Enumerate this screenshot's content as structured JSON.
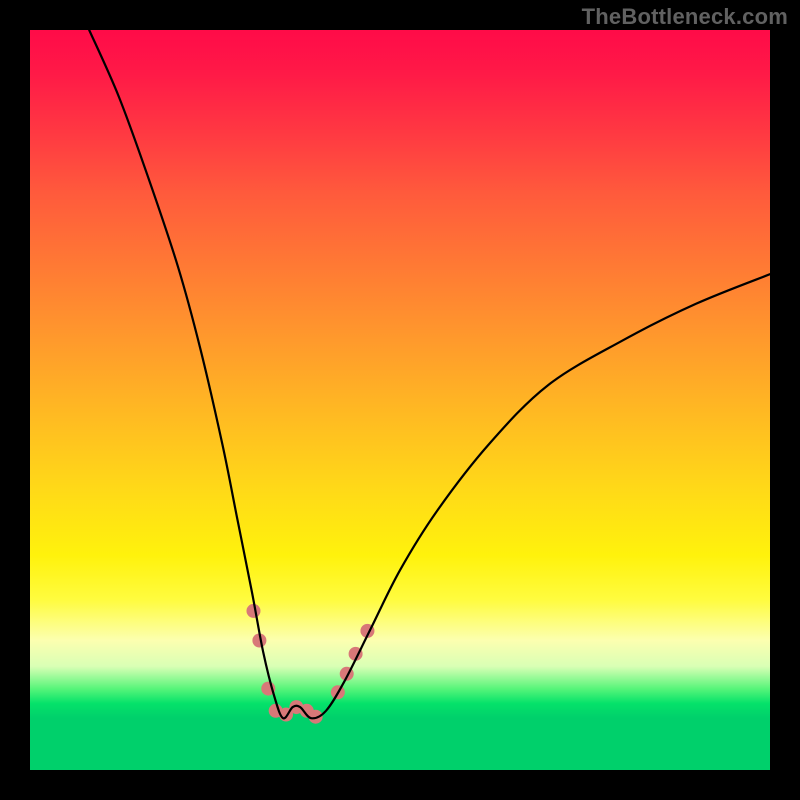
{
  "watermark": "TheBottleneck.com",
  "colors": {
    "frame": "#000000",
    "curve": "#000000",
    "marker": "#d87878",
    "gradient_top": "#ff0b48",
    "gradient_bottom": "#00d06b"
  },
  "chart_data": {
    "type": "line",
    "title": "",
    "xlabel": "",
    "ylabel": "",
    "xlim": [
      0,
      100
    ],
    "ylim": [
      0,
      100
    ],
    "grid": false,
    "legend": false,
    "notes": "V-shaped bottleneck curve on red→green vertical gradient background. x is relative horizontal position (0–100). y is bottleneck percentage (0=bottom/green, 100=top/red).",
    "series": [
      {
        "name": "bottleneck-curve",
        "x": [
          8,
          12,
          16,
          20,
          23,
          26,
          28,
          30,
          31.5,
          33,
          34.2,
          35.5,
          36.5,
          38,
          40,
          42.5,
          46,
          50,
          55,
          62,
          70,
          80,
          90,
          100
        ],
        "y": [
          100,
          91,
          80,
          68,
          57,
          44,
          34,
          24,
          16,
          10,
          7,
          8.5,
          8.5,
          7,
          8,
          12,
          19,
          27,
          35,
          44,
          52,
          58,
          63,
          67
        ]
      }
    ],
    "markers": [
      {
        "x": 30.2,
        "y": 21.5
      },
      {
        "x": 31.0,
        "y": 17.5
      },
      {
        "x": 32.2,
        "y": 11.0
      },
      {
        "x": 33.2,
        "y": 8.0
      },
      {
        "x": 34.6,
        "y": 7.5
      },
      {
        "x": 36.0,
        "y": 8.5
      },
      {
        "x": 37.4,
        "y": 8.0
      },
      {
        "x": 38.6,
        "y": 7.2
      },
      {
        "x": 41.6,
        "y": 10.5
      },
      {
        "x": 42.8,
        "y": 13.0
      },
      {
        "x": 44.0,
        "y": 15.7
      },
      {
        "x": 45.6,
        "y": 18.8
      }
    ],
    "marker_radius_px": 7
  }
}
